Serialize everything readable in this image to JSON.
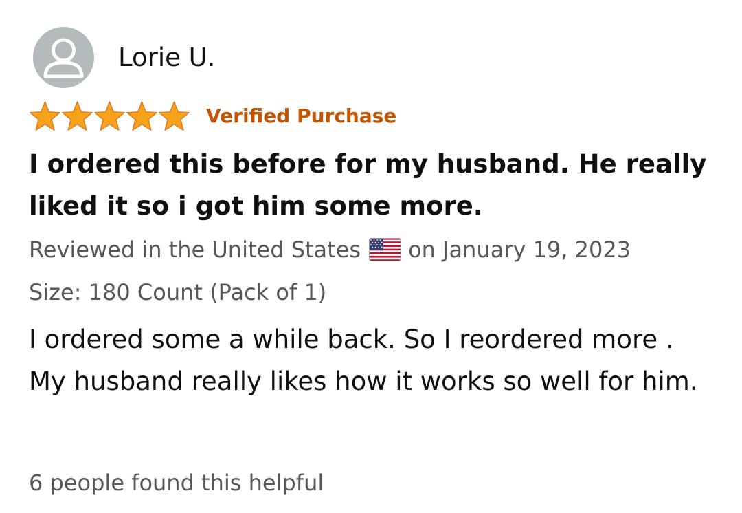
{
  "review": {
    "reviewer_name": "Lorie U.",
    "rating": 5,
    "rating_max": 5,
    "verified_label": "Verified Purchase",
    "title": "I ordered this before for my husband. He really liked it so i got him some more.",
    "reviewed_in_prefix": "Reviewed in the United States",
    "reviewed_date": "on January 19, 2023",
    "flag_icon": "us-flag-icon",
    "size": "Size: 180 Count (Pack of 1)",
    "body": "I ordered some a while back. So I reordered more . My husband really likes how it works so well for him.",
    "helpful": "6 people found this helpful"
  },
  "colors": {
    "star": "#f7a21b",
    "star_outline": "#de7921",
    "verified": "#c45500",
    "avatar_bg": "#b4bbbc",
    "muted_text": "#565959",
    "text": "#0f1111"
  }
}
